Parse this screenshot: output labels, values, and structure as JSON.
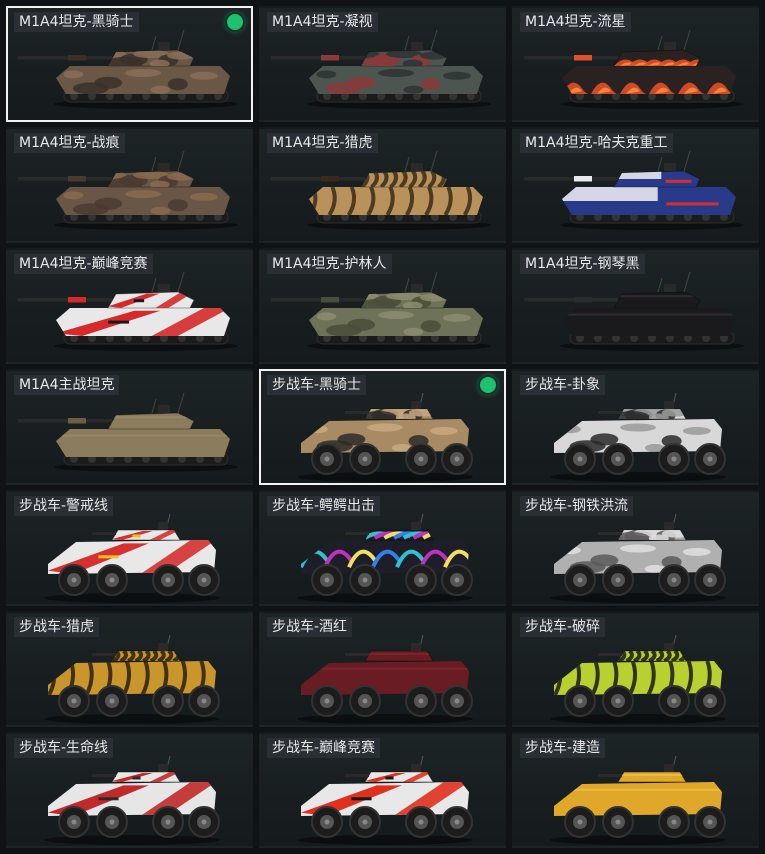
{
  "items": [
    {
      "label": "M1A4坦克-黑骑士",
      "type": "tank",
      "selected": true,
      "equipped": true,
      "colors": {
        "body": "#6b5746",
        "accent": "#3a302a",
        "stripe": "#8a6e58"
      },
      "pattern": "camo"
    },
    {
      "label": "M1A4坦克-凝视",
      "type": "tank",
      "selected": false,
      "equipped": false,
      "colors": {
        "body": "#4d5550",
        "accent": "#8a3a3a",
        "stripe": "#2e3432"
      },
      "pattern": "camo"
    },
    {
      "label": "M1A4坦克-流星",
      "type": "tank",
      "selected": false,
      "equipped": false,
      "colors": {
        "body": "#2a2220",
        "accent": "#e0502a",
        "stripe": "#ff8a3a"
      },
      "pattern": "flame"
    },
    {
      "label": "M1A4坦克-战痕",
      "type": "tank",
      "selected": false,
      "equipped": false,
      "colors": {
        "body": "#6a5646",
        "accent": "#4a3a30",
        "stripe": "#8a6a50"
      },
      "pattern": "camo"
    },
    {
      "label": "M1A4坦克-猎虎",
      "type": "tank",
      "selected": false,
      "equipped": false,
      "colors": {
        "body": "#b8925a",
        "accent": "#3a2a1a",
        "stripe": "#d6b07a"
      },
      "pattern": "tiger"
    },
    {
      "label": "M1A4坦克-哈夫克重工",
      "type": "tank",
      "selected": false,
      "equipped": false,
      "colors": {
        "body": "#2a3a8a",
        "accent": "#e8e8f0",
        "stripe": "#d03030"
      },
      "pattern": "brand"
    },
    {
      "label": "M1A4坦克-巅峰竞赛",
      "type": "tank",
      "selected": false,
      "equipped": false,
      "colors": {
        "body": "#e8e8e8",
        "accent": "#d62a2a",
        "stripe": "#1a1a1a"
      },
      "pattern": "race"
    },
    {
      "label": "M1A4坦克-护林人",
      "type": "tank",
      "selected": false,
      "equipped": false,
      "colors": {
        "body": "#6e7258",
        "accent": "#4a4e3a",
        "stripe": "#8c8c70"
      },
      "pattern": "camo"
    },
    {
      "label": "M1A4坦克-钢琴黑",
      "type": "tank",
      "selected": false,
      "equipped": false,
      "colors": {
        "body": "#1a1a1c",
        "accent": "#2c2c30",
        "stripe": "#3a3a3e"
      },
      "pattern": "plain"
    },
    {
      "label": "M1A4主战坦克",
      "type": "tank",
      "selected": false,
      "equipped": false,
      "colors": {
        "body": "#8a7c5c",
        "accent": "#6a5e46",
        "stripe": "#a09070"
      },
      "pattern": "plain"
    },
    {
      "label": "步战车-黑骑士",
      "type": "ifv",
      "selected": true,
      "equipped": true,
      "colors": {
        "body": "#a88a64",
        "accent": "#2e2a28",
        "stripe": "#c8a880"
      },
      "pattern": "camo"
    },
    {
      "label": "步战车-卦象",
      "type": "ifv",
      "selected": false,
      "equipped": false,
      "colors": {
        "body": "#d8d8d8",
        "accent": "#2a2a2a",
        "stripe": "#9a9a9a"
      },
      "pattern": "camo"
    },
    {
      "label": "步战车-警戒线",
      "type": "ifv",
      "selected": false,
      "equipped": false,
      "colors": {
        "body": "#e8e8e8",
        "accent": "#d63030",
        "stripe": "#f0c020"
      },
      "pattern": "race"
    },
    {
      "label": "步战车-鳄鳄出击",
      "type": "ifv",
      "selected": false,
      "equipped": false,
      "colors": {
        "body": "#1e1e28",
        "accent": "#30c0d0",
        "stripe": "#c030c0"
      },
      "pattern": "graffiti"
    },
    {
      "label": "步战车-钢铁洪流",
      "type": "ifv",
      "selected": false,
      "equipped": false,
      "colors": {
        "body": "#b0b0b0",
        "accent": "#5a5a5a",
        "stripe": "#e0e0e0"
      },
      "pattern": "camo"
    },
    {
      "label": "步战车-猎虎",
      "type": "ifv",
      "selected": false,
      "equipped": false,
      "colors": {
        "body": "#c8962a",
        "accent": "#2a1e14",
        "stripe": "#e0b050"
      },
      "pattern": "tiger"
    },
    {
      "label": "步战车-酒红",
      "type": "ifv",
      "selected": false,
      "equipped": false,
      "colors": {
        "body": "#6a1c24",
        "accent": "#3a1014",
        "stripe": "#8a2a30"
      },
      "pattern": "plain"
    },
    {
      "label": "步战车-破碎",
      "type": "ifv",
      "selected": false,
      "equipped": false,
      "colors": {
        "body": "#b8d030",
        "accent": "#1a1a1a",
        "stripe": "#d8e860"
      },
      "pattern": "tiger"
    },
    {
      "label": "步战车-生命线",
      "type": "ifv",
      "selected": false,
      "equipped": false,
      "colors": {
        "body": "#e6e6e6",
        "accent": "#c02a2a",
        "stripe": "#2a2a2a"
      },
      "pattern": "race"
    },
    {
      "label": "步战车-巅峰竞赛",
      "type": "ifv",
      "selected": false,
      "equipped": false,
      "colors": {
        "body": "#e8e8e8",
        "accent": "#e0301e",
        "stripe": "#1a1a1a"
      },
      "pattern": "race"
    },
    {
      "label": "步战车-建造",
      "type": "ifv",
      "selected": false,
      "equipped": false,
      "colors": {
        "body": "#e0a82a",
        "accent": "#2a2a2a",
        "stripe": "#f0c850"
      },
      "pattern": "plain"
    }
  ]
}
